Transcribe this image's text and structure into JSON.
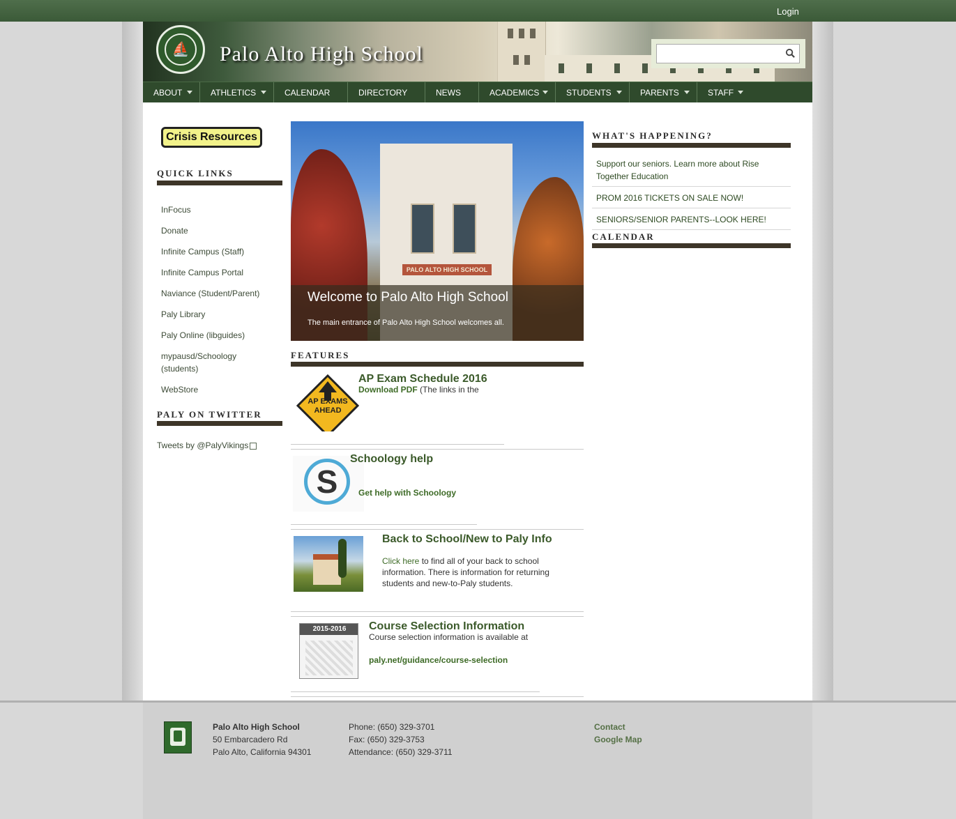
{
  "header": {
    "login_label": "Login",
    "site_title": "Palo Alto High School",
    "logo_text": "PALO ALTO SENIOR HIGH SCHOOL Vikings",
    "search_placeholder": ""
  },
  "nav": {
    "items": [
      {
        "label": "ABOUT",
        "has_submenu": true
      },
      {
        "label": "ATHLETICS",
        "has_submenu": true
      },
      {
        "label": "CALENDAR",
        "has_submenu": false
      },
      {
        "label": "DIRECTORY",
        "has_submenu": false
      },
      {
        "label": "NEWS",
        "has_submenu": false
      },
      {
        "label": "ACADEMICS",
        "has_submenu": true
      },
      {
        "label": "STUDENTS",
        "has_submenu": true
      },
      {
        "label": "PARENTS",
        "has_submenu": true
      },
      {
        "label": "STAFF",
        "has_submenu": true
      }
    ]
  },
  "sidebar": {
    "crisis_label": "Crisis Resources",
    "quick_links_title": "QUICK LINKS",
    "quick_links": [
      "InFocus",
      "Donate",
      "Infinite Campus (Staff)",
      "Infinite Campus Portal",
      "Naviance (Student/Parent)",
      "Paly Library",
      "Paly Online (libguides)",
      "mypausd/Schoology (students)",
      "WebStore"
    ],
    "twitter_title": "PALY ON TWITTER",
    "twitter_link": "Tweets by @PalyVikings"
  },
  "hero": {
    "building_sign": "PALO ALTO HIGH SCHOOL",
    "caption_title": "Welcome to Palo Alto High School",
    "caption_text": "The main entrance of Palo Alto High School welcomes all."
  },
  "features": {
    "title": "FEATURES",
    "ap": {
      "sign_text": "AP EXAMS AHEAD",
      "title": "AP Exam Schedule 2016",
      "link": "Download PDF",
      "text": " (The links in the"
    },
    "schoology": {
      "logo_letter": "S",
      "title": "Schoology help",
      "link": "Get help with Schoology"
    },
    "back_to_school": {
      "title": "Back to School/New to Paly Info",
      "link": "Click here",
      "text": " to find all of your back to school information. There is information for returning students and new-to-Paly students."
    },
    "course": {
      "thumb_text": "2015-2016",
      "title": "Course Selection Information",
      "text": "Course selection information is available at",
      "link": "paly.net/guidance/course-selection"
    }
  },
  "whats_happening": {
    "title": "WHAT'S HAPPENING?",
    "items": [
      "Support our seniors. Learn more about Rise Together Education",
      "PROM 2016 TICKETS ON SALE NOW!",
      "SENIORS/SENIOR PARENTS--LOOK HERE!"
    ],
    "calendar_title": "CALENDAR"
  },
  "footer": {
    "school_name": "Palo Alto High School",
    "address1": "50 Embarcadero Rd",
    "address2": "Palo Alto, California 94301",
    "phone": "Phone: (650) 329-3701",
    "fax": "Fax: (650) 329-3753",
    "attendance": "Attendance: (650) 329-3711",
    "contact_label": "Contact",
    "map_label": "Google Map"
  },
  "colors": {
    "nav_bg": "#2f4a2c",
    "top_bar": "#3b5a38",
    "section_rule": "#3d3528",
    "link_green": "#3e6b27"
  }
}
